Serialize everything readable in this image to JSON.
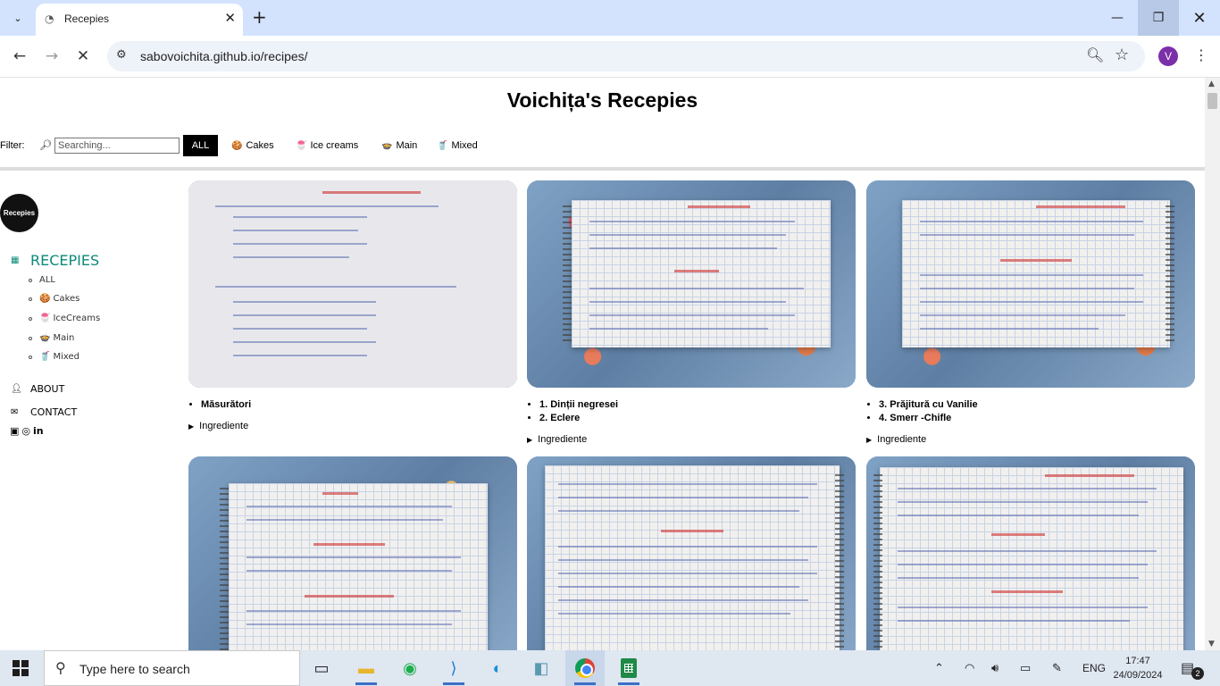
{
  "browser": {
    "tab_title": "Recepies",
    "url": "sabovoichita.github.io/recipes/",
    "profile_initial": "V"
  },
  "page": {
    "title": "Voichița's Recepies",
    "filter": {
      "label": "Filter:",
      "search_placeholder": "Searching...",
      "buttons": {
        "all": "ALL",
        "cakes": "Cakes",
        "ice": "Ice creams",
        "main": "Main",
        "mixed": "Mixed"
      },
      "active": "ALL"
    },
    "sidebar": {
      "logo_text": "Recepies",
      "recepies": "RECEPIES",
      "sub": {
        "all": "ALL",
        "cakes": "Cakes",
        "ice": "IceCreams",
        "main": "Main",
        "mixed": "Mixed"
      },
      "about": "ABOUT",
      "contact": "CONTACT"
    },
    "cards": [
      {
        "titles": [
          "Măsurători"
        ],
        "details": "Ingrediente"
      },
      {
        "titles": [
          "1. Dinții negresei",
          "2. Eclere"
        ],
        "details": "Ingrediente"
      },
      {
        "titles": [
          "3. Prăjitură cu Vanilie",
          "4. Smerr -Chifle"
        ],
        "details": "Ingrediente"
      }
    ]
  },
  "taskbar": {
    "search_text": "Type here to search",
    "language": "ENG",
    "time": "17:47",
    "date": "24/09/2024",
    "notifications": "2"
  },
  "icons": [
    "tab-dropdown-icon",
    "back-arrow-icon",
    "forward-arrow-icon",
    "stop-loading-icon",
    "site-info-icon",
    "zoom-icon",
    "star-icon",
    "menu-icon",
    "windows-start-icon",
    "search-icon",
    "chrome-icon"
  ]
}
